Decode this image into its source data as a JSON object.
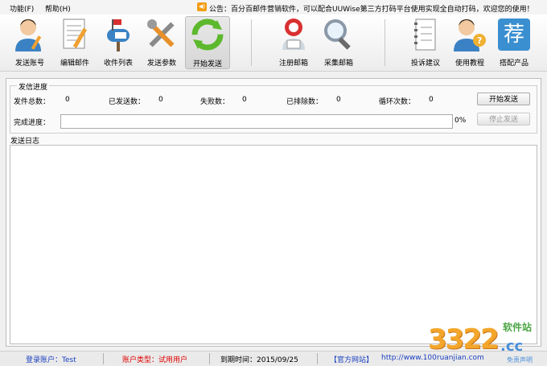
{
  "menu": {
    "function": "功能(F)",
    "help": "帮助(H)"
  },
  "notice": {
    "icon": "speaker-icon",
    "text": "公告：百分百邮件营销软件，可以配合UUWise第三方打码平台使用实现全自动打码，欢迎您的使用！"
  },
  "toolbar": {
    "items": [
      {
        "label": "发送账号",
        "icon": "user-account-icon",
        "active": false
      },
      {
        "label": "编辑邮件",
        "icon": "edit-document-icon",
        "active": false
      },
      {
        "label": "收件列表",
        "icon": "mailbox-icon",
        "active": false
      },
      {
        "label": "发送参数",
        "icon": "tools-icon",
        "active": false
      },
      {
        "label": "开始发送",
        "icon": "refresh-icon",
        "active": true
      },
      {
        "label": "注册邮箱",
        "icon": "register-mail-icon",
        "active": false
      },
      {
        "label": "采集邮箱",
        "icon": "magnifier-icon",
        "active": false
      },
      {
        "label": "投诉建议",
        "icon": "notebook-icon",
        "active": false
      },
      {
        "label": "使用教程",
        "icon": "help-user-icon",
        "active": false
      },
      {
        "label": "搭配产品",
        "icon": "product-icon",
        "active": false
      }
    ],
    "product_glyph": "荐"
  },
  "progress": {
    "group_title": "发信进度",
    "stats": [
      {
        "label": "发件总数：",
        "value": "0"
      },
      {
        "label": "已发送数：",
        "value": "0"
      },
      {
        "label": "失败数：",
        "value": "0"
      },
      {
        "label": "已排除数：",
        "value": "0"
      },
      {
        "label": "循环次数：",
        "value": "0"
      }
    ],
    "completion_label": "完成进度：",
    "percent": "0%",
    "start_button": "开始发送",
    "stop_button": "停止发送"
  },
  "log": {
    "title": "发送日志"
  },
  "status": {
    "login": "登录账户：Test",
    "account_type": "账户类型：试用用户",
    "expiry": "到期时间：2015/09/25",
    "official": "【官方网站】",
    "url": "http://www.100ruanjian.com"
  },
  "watermark": {
    "number": "3322",
    "domain": ".cc",
    "site": "软件站",
    "free": "免责声明"
  },
  "colors": {
    "account_type": "#e00000",
    "link": "#1a3fc0",
    "active_bg": "#d6d6d6"
  }
}
